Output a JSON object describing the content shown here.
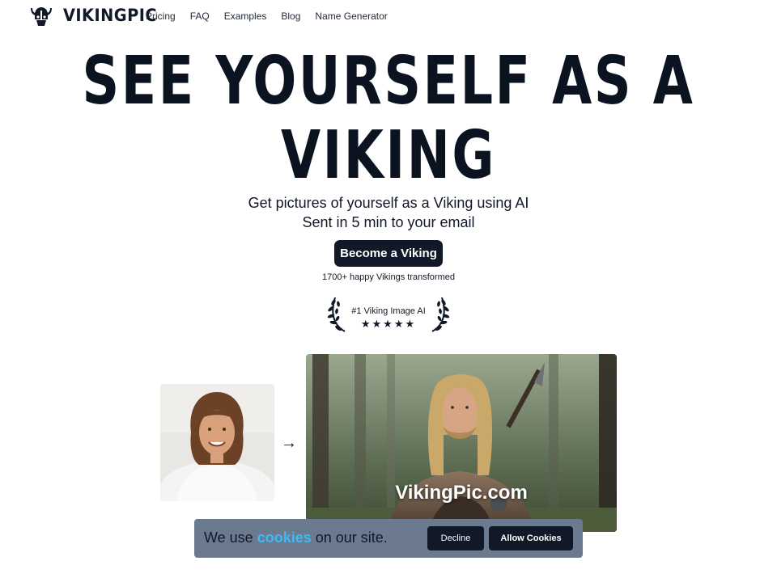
{
  "header": {
    "logo_text": "VIKINGPIC",
    "nav": [
      "Pricing",
      "FAQ",
      "Examples",
      "Blog",
      "Name Generator"
    ]
  },
  "hero": {
    "title_line1": "SEE YOURSELF AS A",
    "title_line2": "VIKING",
    "subtitle_line1": "Get pictures of yourself as a Viking using AI",
    "subtitle_line2": "Sent in 5 min to your email",
    "cta_label": "Become a Viking",
    "social_proof": "1700+ happy Vikings transformed",
    "award_label": "#1 Viking Image AI",
    "rating": "★★★★★"
  },
  "gallery": {
    "arrow": "→",
    "watermark": "VikingPic.com"
  },
  "cookie_banner": {
    "text_before": "We use ",
    "link_text": "cookies",
    "text_after": " on our site.",
    "decline_label": "Decline",
    "allow_label": "Allow Cookies"
  },
  "colors": {
    "primary": "#111827",
    "cookie_bg": "#6b7a8f",
    "link": "#38bdf8"
  }
}
